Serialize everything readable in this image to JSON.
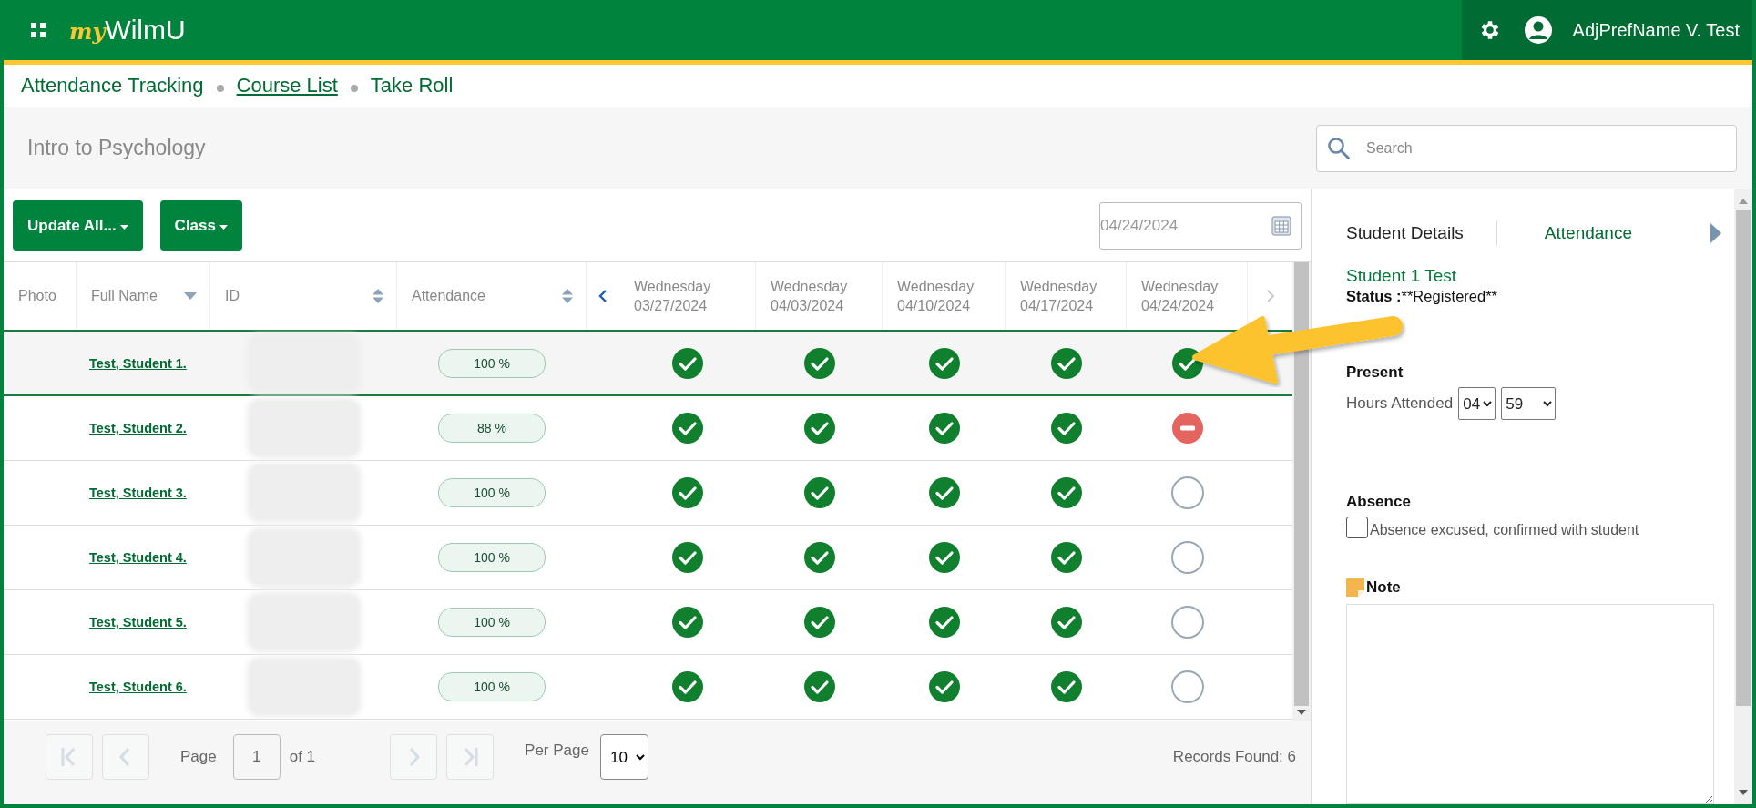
{
  "header": {
    "logo": {
      "part_1": "my",
      "part_2": "WilmU"
    },
    "user_name": "AdjPrefName V. Test"
  },
  "breadcrumbs": [
    {
      "label": "Attendance Tracking",
      "link": false
    },
    {
      "label": "Course List",
      "link": true
    },
    {
      "label": "Take Roll",
      "link": false
    }
  ],
  "course_title": "Intro to Psychology",
  "search": {
    "placeholder": "Search"
  },
  "toolbar": {
    "buttons": [
      "Update All...",
      "Class"
    ],
    "date": "04/24/2024"
  },
  "table": {
    "columns": [
      {
        "label": "Photo",
        "kind": "plain"
      },
      {
        "label": "Full Name",
        "kind": "sorted"
      },
      {
        "label": "ID",
        "kind": "sortable"
      },
      {
        "label": "Attendance",
        "kind": "sortable"
      }
    ],
    "date_columns": [
      {
        "day": "Wednesday",
        "date": "03/27/2024"
      },
      {
        "day": "Wednesday",
        "date": "04/03/2024"
      },
      {
        "day": "Wednesday",
        "date": "04/10/2024"
      },
      {
        "day": "Wednesday",
        "date": "04/17/2024"
      },
      {
        "day": "Wednesday",
        "date": "04/24/2024"
      }
    ],
    "rows": [
      {
        "name": "Test, Student 1.",
        "attendance": "100 %",
        "selected": true,
        "marks": [
          {
            "kind": "present"
          },
          {
            "kind": "present"
          },
          {
            "kind": "present"
          },
          {
            "kind": "present"
          },
          {
            "kind": "present"
          }
        ]
      },
      {
        "name": "Test, Student 2.",
        "attendance": "88 %",
        "selected": false,
        "marks": [
          {
            "kind": "present"
          },
          {
            "kind": "present"
          },
          {
            "kind": "present"
          },
          {
            "kind": "present"
          },
          {
            "kind": "absent"
          }
        ]
      },
      {
        "name": "Test, Student 3.",
        "attendance": "100 %",
        "selected": false,
        "marks": [
          {
            "kind": "present"
          },
          {
            "kind": "present"
          },
          {
            "kind": "present"
          },
          {
            "kind": "present"
          },
          {
            "kind": "unmarked"
          }
        ]
      },
      {
        "name": "Test, Student 4.",
        "attendance": "100 %",
        "selected": false,
        "marks": [
          {
            "kind": "present"
          },
          {
            "kind": "present"
          },
          {
            "kind": "present"
          },
          {
            "kind": "present"
          },
          {
            "kind": "unmarked"
          }
        ]
      },
      {
        "name": "Test, Student 5.",
        "attendance": "100 %",
        "selected": false,
        "marks": [
          {
            "kind": "present"
          },
          {
            "kind": "present"
          },
          {
            "kind": "present"
          },
          {
            "kind": "present"
          },
          {
            "kind": "unmarked"
          }
        ]
      },
      {
        "name": "Test, Student 6.",
        "attendance": "100 %",
        "selected": false,
        "marks": [
          {
            "kind": "present"
          },
          {
            "kind": "present"
          },
          {
            "kind": "present"
          },
          {
            "kind": "present"
          },
          {
            "kind": "unmarked"
          }
        ]
      }
    ]
  },
  "pager": {
    "page_label": "Page",
    "page": "1",
    "of": "of 1",
    "per_page_label": "Per Page",
    "per_page": "10",
    "records": "Records Found: 6"
  },
  "details": {
    "tabs": [
      {
        "label": "Student Details",
        "selected": true
      },
      {
        "label": "Attendance",
        "selected": false
      }
    ],
    "student_name": "Student 1 Test",
    "status_label": "Status :",
    "status_value": "**Registered**",
    "present_label": "Present",
    "hours_label": "Hours Attended",
    "hours": "04",
    "minutes": "59",
    "absence_label": "Absence",
    "excused": {
      "label": "Absence excused, confirmed with student",
      "checked": false
    },
    "note_label": "Note"
  }
}
